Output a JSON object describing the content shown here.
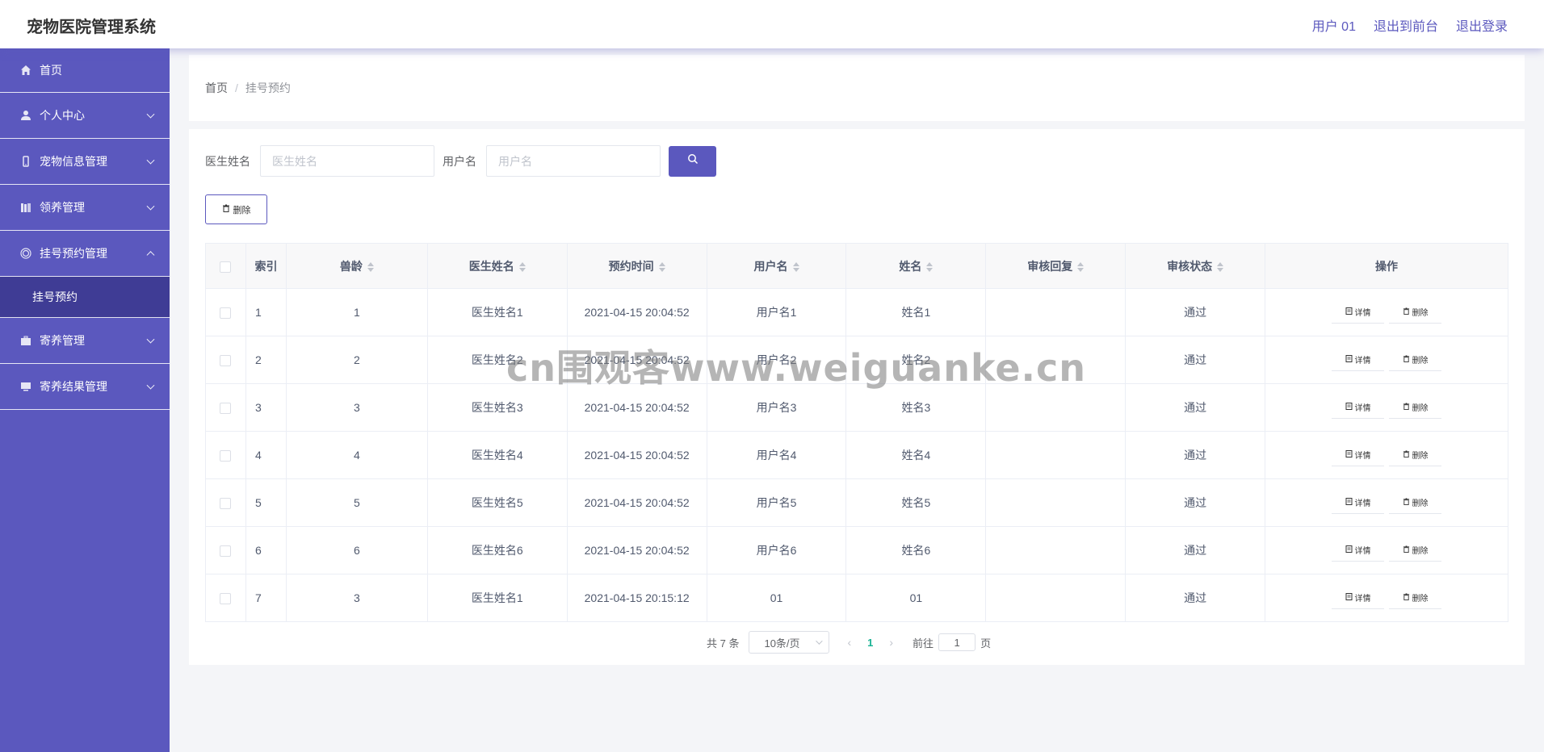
{
  "header": {
    "title": "宠物医院管理系统",
    "user": "用户 01",
    "back_to_front": "退出到前台",
    "logout": "退出登录"
  },
  "sidebar": {
    "items": [
      {
        "label": "首页",
        "icon": "home-icon"
      },
      {
        "label": "个人中心",
        "icon": "user-icon"
      },
      {
        "label": "宠物信息管理",
        "icon": "phone-icon"
      },
      {
        "label": "领养管理",
        "icon": "books-icon"
      },
      {
        "label": "挂号预约管理",
        "icon": "target-icon"
      },
      {
        "label": "挂号预约",
        "icon": ""
      },
      {
        "label": "寄养管理",
        "icon": "briefcase-icon"
      },
      {
        "label": "寄养结果管理",
        "icon": "monitor-icon"
      }
    ]
  },
  "breadcrumb": {
    "home": "首页",
    "separator": "/",
    "current": "挂号预约"
  },
  "search": {
    "doctor_label": "医生姓名",
    "doctor_placeholder": "医生姓名",
    "username_label": "用户名",
    "username_placeholder": "用户名"
  },
  "toolbar": {
    "delete_label": "删除"
  },
  "table": {
    "columns": [
      "索引",
      "兽龄",
      "医生姓名",
      "预约时间",
      "用户名",
      "姓名",
      "审核回复",
      "审核状态",
      "操作"
    ],
    "rows": [
      {
        "index": "1",
        "age": "1",
        "doctor": "医生姓名1",
        "time": "2021-04-15 20:04:52",
        "username": "用户名1",
        "name": "姓名1",
        "reply": "",
        "status": "通过"
      },
      {
        "index": "2",
        "age": "2",
        "doctor": "医生姓名2",
        "time": "2021-04-15 20:04:52",
        "username": "用户名2",
        "name": "姓名2",
        "reply": "",
        "status": "通过"
      },
      {
        "index": "3",
        "age": "3",
        "doctor": "医生姓名3",
        "time": "2021-04-15 20:04:52",
        "username": "用户名3",
        "name": "姓名3",
        "reply": "",
        "status": "通过"
      },
      {
        "index": "4",
        "age": "4",
        "doctor": "医生姓名4",
        "time": "2021-04-15 20:04:52",
        "username": "用户名4",
        "name": "姓名4",
        "reply": "",
        "status": "通过"
      },
      {
        "index": "5",
        "age": "5",
        "doctor": "医生姓名5",
        "time": "2021-04-15 20:04:52",
        "username": "用户名5",
        "name": "姓名5",
        "reply": "",
        "status": "通过"
      },
      {
        "index": "6",
        "age": "6",
        "doctor": "医生姓名6",
        "time": "2021-04-15 20:04:52",
        "username": "用户名6",
        "name": "姓名6",
        "reply": "",
        "status": "通过"
      },
      {
        "index": "7",
        "age": "3",
        "doctor": "医生姓名1",
        "time": "2021-04-15 20:15:12",
        "username": "01",
        "name": "01",
        "reply": "",
        "status": "通过"
      }
    ],
    "detail_label": "详情",
    "delete_label": "删除"
  },
  "pagination": {
    "total": "共 7 条",
    "page_size": "10条/页",
    "current_page": "1",
    "goto_label": "前往",
    "goto_value": "1",
    "page_suffix": "页"
  },
  "watermark": "cn围观客www.weiguanke.cn",
  "colors": {
    "primary": "#5b58be",
    "sidebar_active": "#3f3c95",
    "page_active": "#1ab394"
  }
}
